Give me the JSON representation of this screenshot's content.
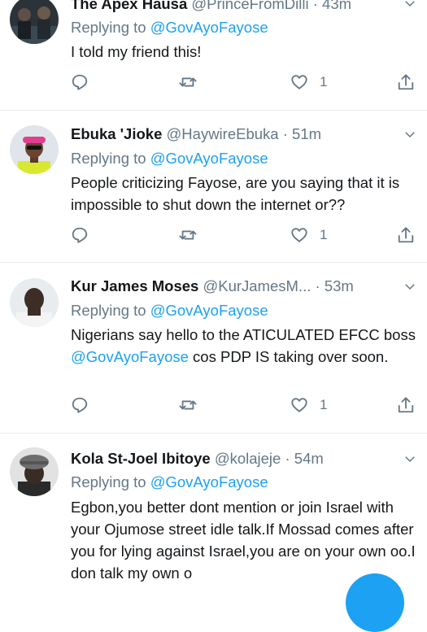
{
  "tweets": [
    {
      "name": "The Apex Hausa",
      "handle": "@PrinceFromDilli",
      "dot": "·",
      "time": "43m",
      "replying_prefix": "Replying to",
      "replying_to": "@GovAyoFayose",
      "text_parts": [
        "I told my friend this!"
      ],
      "likes": "1"
    },
    {
      "name": "Ebuka 'Jioke",
      "handle": "@HaywireEbuka",
      "dot": "·",
      "time": "51m",
      "replying_prefix": "Replying to",
      "replying_to": "@GovAyoFayose",
      "text_parts": [
        "People criticizing Fayose, are you saying that it is impossible to shut down the internet or??"
      ],
      "likes": "1"
    },
    {
      "name": "Kur James Moses",
      "handle": "@KurJamesM...",
      "dot": "·",
      "time": "53m",
      "replying_prefix": "Replying to",
      "replying_to": "@GovAyoFayose",
      "text_parts": [
        "Nigerians say hello to the ATICULATED EFCC boss ",
        "@GovAyoFayose",
        " cos PDP IS taking over soon."
      ],
      "likes": "1"
    },
    {
      "name": "Kola St-Joel Ibitoye",
      "handle": "@kolajeje",
      "dot": "·",
      "time": "54m",
      "replying_prefix": "Replying to",
      "replying_to": "@GovAyoFayose",
      "text_parts": [
        "Egbon,you better dont mention or join Israel with your Ojumose street  idle talk.If Mossad comes after you for lying against Israel,you are on your own oo.I don talk my own o"
      ],
      "likes": ""
    }
  ],
  "colors": {
    "accent": "#1da1f2",
    "muted": "#657786",
    "text": "#14171a",
    "divider": "#e6ecf0"
  },
  "icons": [
    "reply-icon",
    "retweet-icon",
    "like-icon",
    "share-icon",
    "chevron-down-icon",
    "compose-fab"
  ]
}
